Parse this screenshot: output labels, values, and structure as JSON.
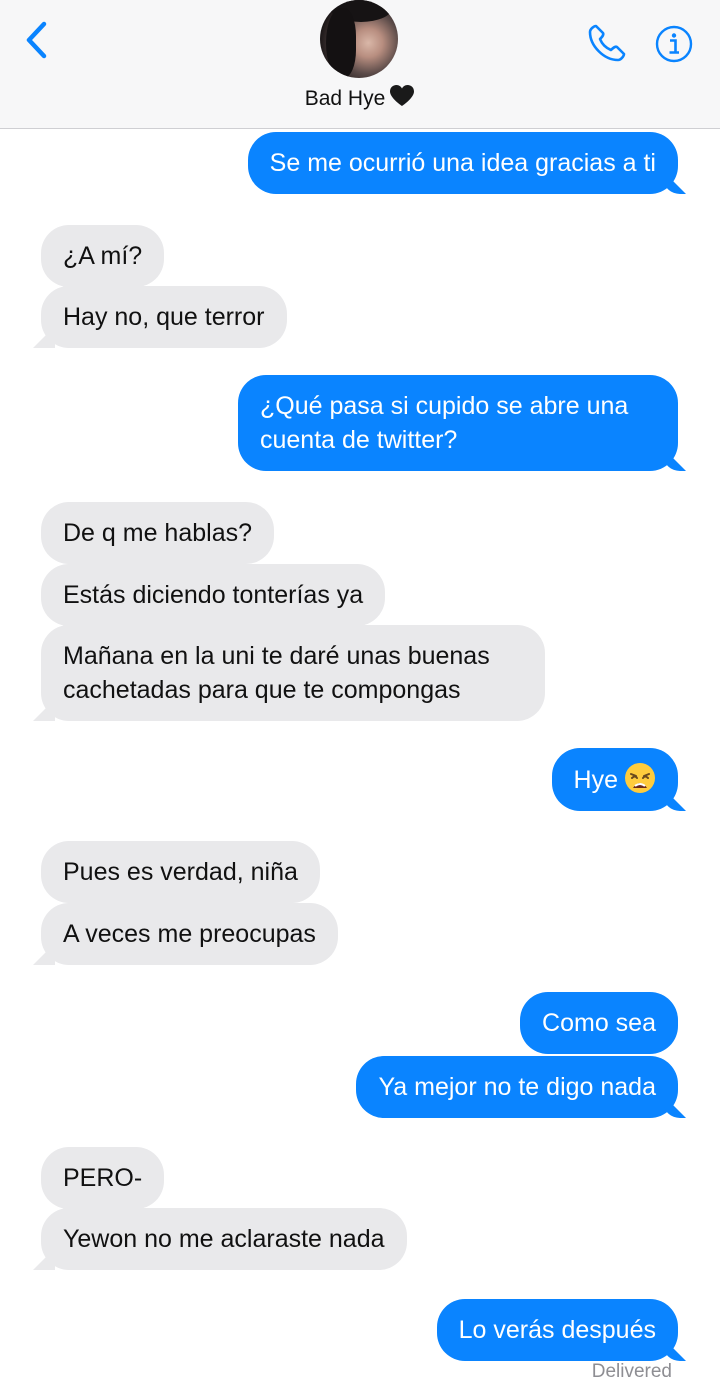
{
  "header": {
    "contact_name": "Bad Hye",
    "back_icon": "chevron-left-icon",
    "call_icon": "phone-icon",
    "info_icon": "info-icon",
    "accent": "#0a84ff"
  },
  "messages": [
    {
      "from": "me",
      "text": "Se me ocurrió una idea gracias a ti"
    },
    {
      "from": "them",
      "text": "¿A mí?"
    },
    {
      "from": "them",
      "text": "Hay no, que terror"
    },
    {
      "from": "me",
      "text": "¿Qué pasa si cupido se abre una cuenta de twitter?"
    },
    {
      "from": "them",
      "text": "De q me hablas?"
    },
    {
      "from": "them",
      "text": "Estás diciendo tonterías ya"
    },
    {
      "from": "them",
      "text": "Mañana en la uni te daré unas buenas cachetadas para que te compongas"
    },
    {
      "from": "me",
      "text": "Hye",
      "emoji": "weary-face-emoji"
    },
    {
      "from": "them",
      "text": "Pues es verdad, niña"
    },
    {
      "from": "them",
      "text": "A veces me preocupas"
    },
    {
      "from": "me",
      "text": "Como sea"
    },
    {
      "from": "me",
      "text": "Ya mejor no te digo nada"
    },
    {
      "from": "them",
      "text": "PERO-"
    },
    {
      "from": "them",
      "text": "Yewon no me aclaraste nada"
    },
    {
      "from": "me",
      "text": "Lo verás después"
    }
  ],
  "status": {
    "delivered": "Delivered"
  },
  "colors": {
    "sent_bubble": "#0a84ff",
    "received_bubble": "#e9e9eb"
  }
}
